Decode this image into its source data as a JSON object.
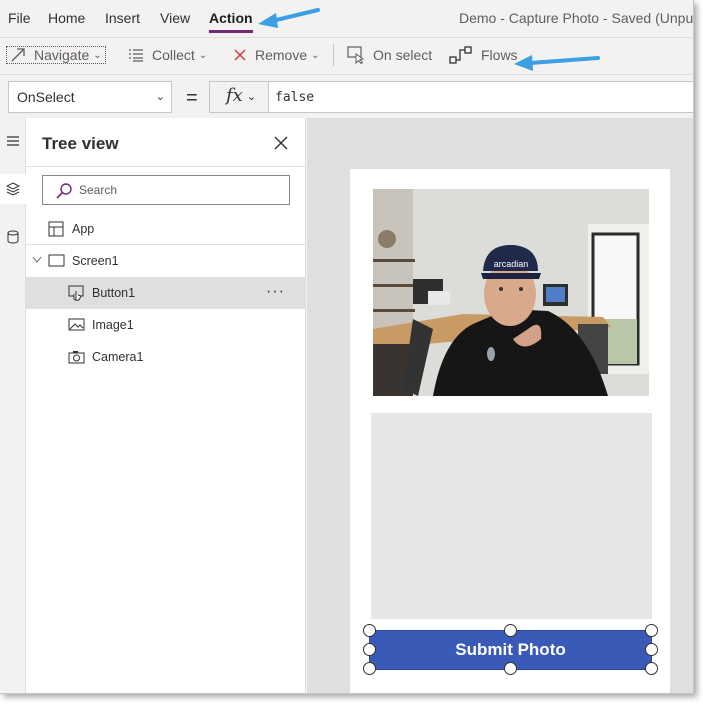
{
  "menubar": {
    "items": [
      {
        "label": "File"
      },
      {
        "label": "Home"
      },
      {
        "label": "Insert"
      },
      {
        "label": "View"
      },
      {
        "label": "Action",
        "active": true
      }
    ],
    "title": "Demo - Capture Photo - Saved (Unpu"
  },
  "toolbar": {
    "navigate": "Navigate",
    "collect": "Collect",
    "remove": "Remove",
    "on_select": "On select",
    "flows": "Flows"
  },
  "formulabar": {
    "property": "OnSelect",
    "fx": "fx",
    "formula": "false"
  },
  "tree": {
    "title": "Tree view",
    "search_placeholder": "Search",
    "items": [
      {
        "label": "App",
        "icon": "app-icon"
      },
      {
        "label": "Screen1",
        "icon": "screen-icon",
        "expanded": true
      },
      {
        "label": "Button1",
        "icon": "button-icon",
        "selected": true,
        "more": "···"
      },
      {
        "label": "Image1",
        "icon": "image-icon"
      },
      {
        "label": "Camera1",
        "icon": "camera-icon"
      }
    ]
  },
  "canvas": {
    "submit_label": "Submit Photo",
    "camera_badge": "arcadian"
  },
  "colors": {
    "accent": "#742774",
    "button": "#3a5ab7",
    "arrow": "#3c9ee3"
  }
}
